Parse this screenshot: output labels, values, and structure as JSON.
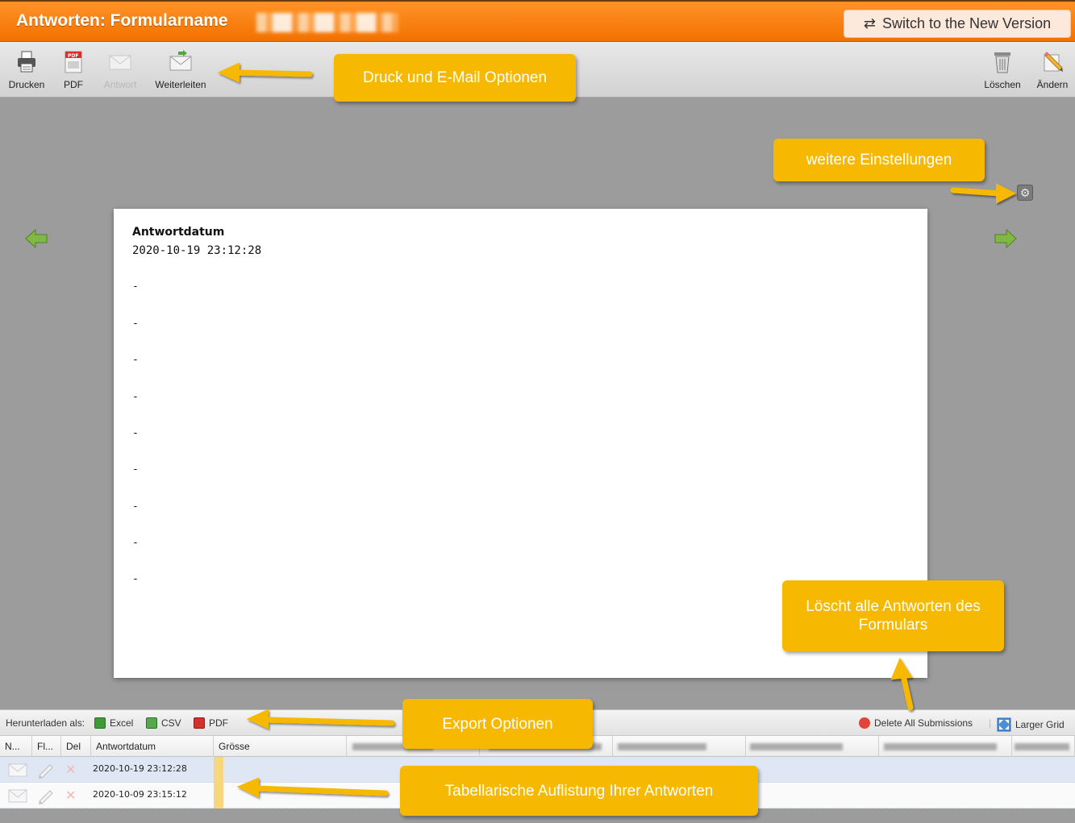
{
  "title": {
    "prefix": "Antworten:",
    "form_name": "Formularname"
  },
  "switch_button": {
    "icon": "swap-arrows-icon",
    "label": "Switch to the New Version"
  },
  "toolbar": {
    "left": [
      {
        "label": "Drucken",
        "icon": "printer-icon",
        "enabled": true
      },
      {
        "label": "PDF",
        "icon": "pdf-icon",
        "enabled": true
      },
      {
        "label": "Antwort",
        "icon": "envelope-icon",
        "enabled": false
      },
      {
        "label": "Weiterleiten",
        "icon": "forward-mail-icon",
        "enabled": true
      }
    ],
    "right": [
      {
        "label": "Löschen",
        "icon": "trash-icon",
        "enabled": true
      },
      {
        "label": "Ändern",
        "icon": "edit-pencil-icon",
        "enabled": true
      }
    ]
  },
  "paper": {
    "field_label": "Antwortdatum",
    "field_value": "2020-10-19 23:12:28",
    "empty_fields": [
      "-",
      "-",
      "-",
      "-",
      "-",
      "-",
      "-",
      "-",
      "-"
    ]
  },
  "callouts": {
    "print_email": "Druck und E-Mail Optionen",
    "settings": "weitere Einstellungen",
    "delete_all": "Löscht alle Antworten des Formulars",
    "export": "Export Optionen",
    "table": "Tabellarische Auflistung Ihrer Antworten"
  },
  "export_bar": {
    "label": "Herunterladen als:",
    "excel": "Excel",
    "csv": "CSV",
    "pdf": "PDF",
    "delete_all": "Delete All Submissions",
    "larger_grid": "Larger Grid"
  },
  "grid": {
    "columns": [
      "N...",
      "Fl...",
      "Del",
      "Antwortdatum",
      "Grösse"
    ],
    "rows": [
      {
        "date": "2020-10-19 23:12:28",
        "selected": true
      },
      {
        "date": "2020-10-09 23:15:12",
        "selected": false
      }
    ]
  },
  "colors": {
    "title_bar": "#f27100",
    "callout": "#f6b800",
    "workspace": "#9c9c9c",
    "selected_row": "#dfe7f4"
  }
}
